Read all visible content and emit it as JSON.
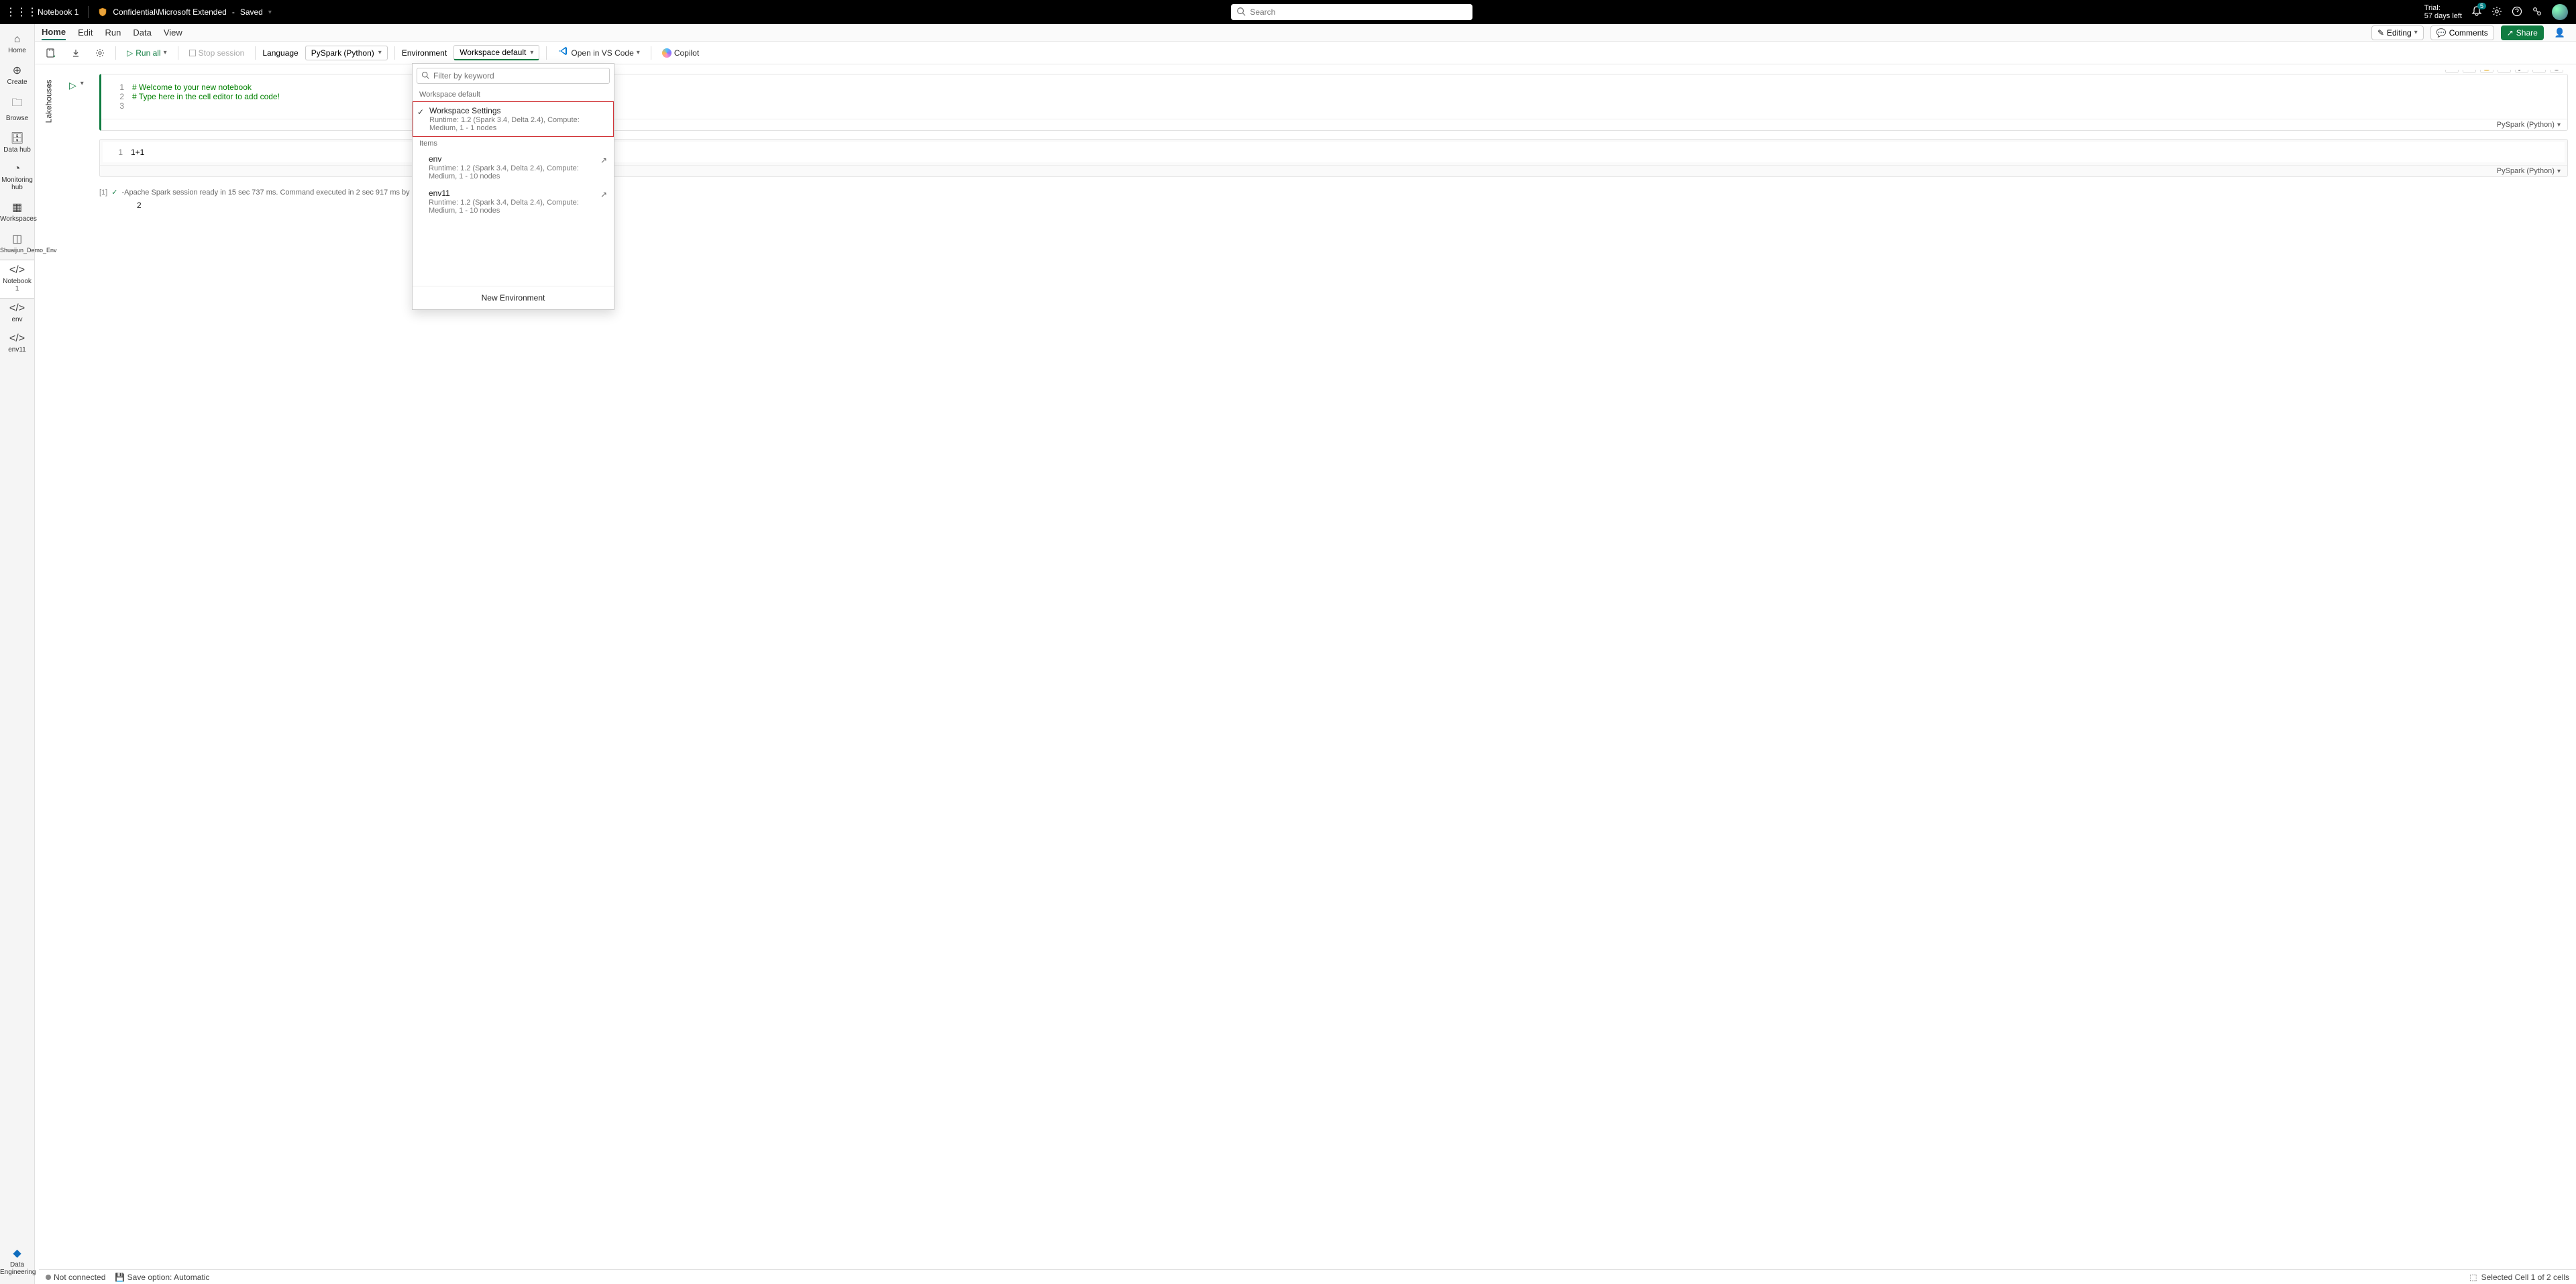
{
  "header": {
    "notebook_name": "Notebook 1",
    "sensitivity": "Confidential\\Microsoft Extended",
    "save_state": "Saved",
    "search_placeholder": "Search",
    "trial_label": "Trial:",
    "trial_days": "57 days left",
    "notif_count": "5"
  },
  "leftrail": {
    "home": "Home",
    "create": "Create",
    "browse": "Browse",
    "data_hub": "Data hub",
    "monitoring": "Monitoring hub",
    "workspaces": "Workspaces",
    "demo_env": "Shuaijun_Demo_Env",
    "notebook1": "Notebook 1",
    "env": "env",
    "env11": "env11",
    "footer": "Data Engineering"
  },
  "tabs": {
    "home": "Home",
    "edit": "Edit",
    "run": "Run",
    "data": "Data",
    "view": "View",
    "editing": "Editing",
    "comments": "Comments",
    "share": "Share"
  },
  "toolbar": {
    "run_all": "Run all",
    "stop": "Stop session",
    "language_label": "Language",
    "language_value": "PySpark (Python)",
    "env_label": "Environment",
    "env_value": "Workspace default",
    "open_vscode": "Open in VS Code",
    "copilot": "Copilot"
  },
  "env_dropdown": {
    "filter_placeholder": "Filter by keyword",
    "section_default": "Workspace default",
    "ws_settings_name": "Workspace Settings",
    "ws_settings_detail": "Runtime: 1.2 (Spark 3.4, Delta 2.4), Compute: Medium, 1 - 1 nodes",
    "section_items": "Items",
    "env_name": "env",
    "env_detail": "Runtime: 1.2 (Spark 3.4, Delta 2.4), Compute: Medium, 1 - 10 nodes",
    "env11_name": "env11",
    "env11_detail": "Runtime: 1.2 (Spark 3.4, Delta 2.4), Compute: Medium, 1 - 10 nodes",
    "new_env": "New Environment"
  },
  "lakehouse_label": "Lakehouses",
  "cell1": {
    "ln1": "1",
    "ln2": "2",
    "ln3": "3",
    "line1": "# Welcome to your new notebook",
    "line2": "# Type here in the cell editor to add code!",
    "kernel": "PySpark (Python)"
  },
  "celltoolbar": {
    "md": "M↓"
  },
  "cell2": {
    "ln1": "1",
    "code": "1+1",
    "idx": "[1]",
    "status": "-Apache Spark session ready in 15 sec 737 ms. Command executed in 2 sec 917 ms by Shuaijun Ye on 4:59:0",
    "out": "2",
    "kernel": "PySpark (Python)"
  },
  "statusbar": {
    "conn": "Not connected",
    "save": "Save option: Automatic",
    "sel": "Selected Cell 1 of 2 cells"
  }
}
